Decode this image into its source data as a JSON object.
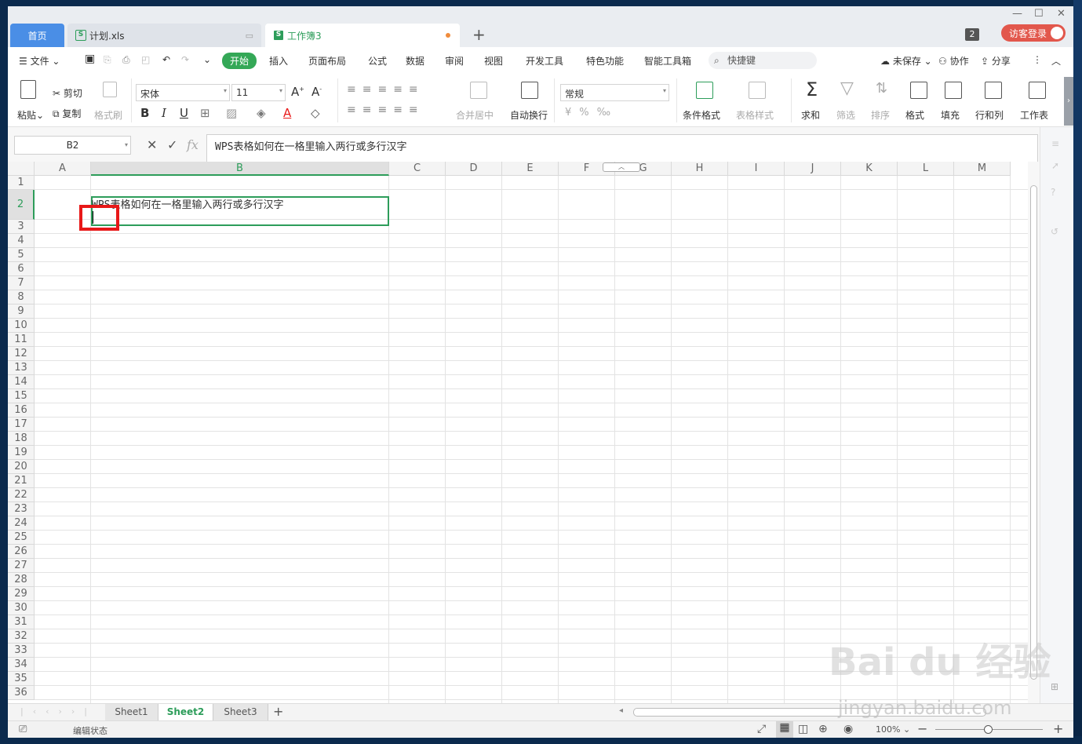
{
  "tabs": {
    "home": "首页",
    "file": "计划.xls",
    "book": "工作簿3",
    "new": "+",
    "window_count": "2",
    "login": "访客登录"
  },
  "menu": {
    "file": "文件",
    "items": [
      "开始",
      "插入",
      "页面布局",
      "公式",
      "数据",
      "审阅",
      "视图",
      "开发工具",
      "特色功能",
      "智能工具箱"
    ],
    "search": "快捷键",
    "unsaved": "未保存",
    "collab": "协作",
    "share": "分享"
  },
  "ribbon": {
    "paste": "粘贴",
    "cut": "剪切",
    "copy": "复制",
    "format_painter": "格式刷",
    "font_name": "宋体",
    "font_size": "11",
    "merge_center": "合并居中",
    "wrap_text": "自动换行",
    "number_format": "常规",
    "cond_format": "条件格式",
    "table_style": "表格样式",
    "sum": "求和",
    "filter": "筛选",
    "sort": "排序",
    "format": "格式",
    "fill": "填充",
    "rows_cols": "行和列",
    "worksheet": "工作表"
  },
  "formula_bar": {
    "cell_ref": "B2",
    "fx": "fx",
    "content": "WPS表格如何在一格里输入两行或多行汉字"
  },
  "grid": {
    "columns": [
      "A",
      "B",
      "C",
      "D",
      "E",
      "F",
      "G",
      "H",
      "I",
      "J",
      "K",
      "L",
      "M"
    ],
    "rows": [
      "1",
      "2",
      "3",
      "4",
      "5",
      "6",
      "7",
      "8",
      "9",
      "10",
      "11",
      "12",
      "13",
      "14",
      "15",
      "16",
      "17",
      "18",
      "19",
      "20",
      "21",
      "22",
      "23",
      "24",
      "25",
      "26",
      "27",
      "28",
      "29",
      "30",
      "31",
      "32",
      "33",
      "34",
      "35",
      "36"
    ],
    "selected_column": "B",
    "selected_row": "2",
    "cell_b2_text": "WPS表格如何在一格里输入两行或多行汉字"
  },
  "sheets": [
    "Sheet1",
    "Sheet2",
    "Sheet3"
  ],
  "active_sheet": "Sheet2",
  "status": {
    "mode": "编辑状态",
    "zoom": "100%"
  },
  "watermark": {
    "brand": "Bai du 经验",
    "url": "jingyan.baidu.com"
  },
  "colors": {
    "accent_green": "#2d9d5a",
    "tab_blue": "#4a8ee6",
    "login_red": "#e2574c",
    "highlight_red": "#e81818"
  }
}
